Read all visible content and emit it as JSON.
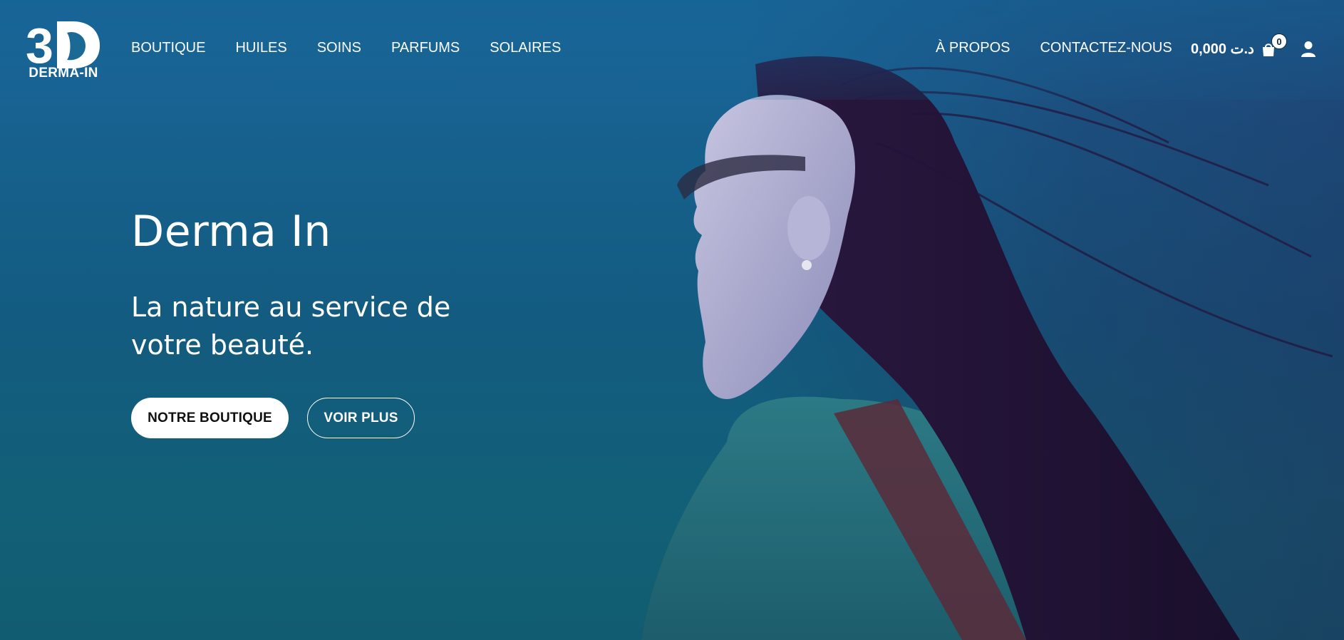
{
  "brand": {
    "logo_mark": "3D",
    "name": "DERMA-IN"
  },
  "nav_left": [
    {
      "label": "BOUTIQUE"
    },
    {
      "label": "HUILES"
    },
    {
      "label": "SOINS"
    },
    {
      "label": "PARFUMS"
    },
    {
      "label": "SOLAIRES"
    }
  ],
  "nav_right": [
    {
      "label": "À PROPOS"
    },
    {
      "label": "CONTACTEZ-NOUS"
    }
  ],
  "cart": {
    "total": "0,000 د.ت",
    "count": "0"
  },
  "hero": {
    "title": "Derma In",
    "subtitle": "La nature au service de votre beauté.",
    "primary_button": "NOTRE BOUTIQUE",
    "secondary_button": "VOIR PLUS"
  },
  "icons": {
    "cart": "shopping-bag-icon",
    "account": "user-icon"
  },
  "colors": {
    "hero_blue": "#17618f",
    "button_bg": "#ffffff",
    "text": "#ffffff"
  }
}
